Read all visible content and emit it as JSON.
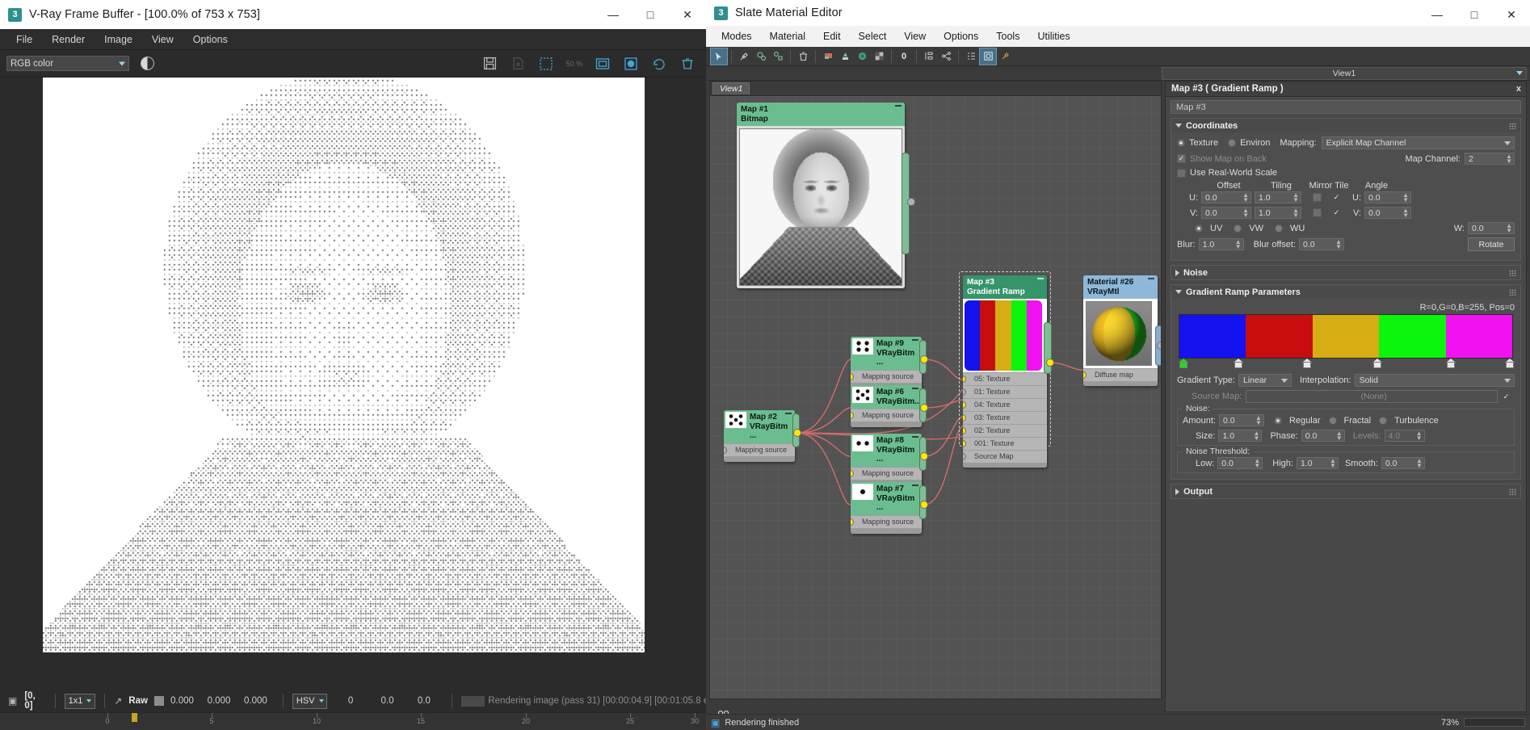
{
  "vfb": {
    "title": "V-Ray Frame Buffer - [100.0% of 753 x 753]",
    "app_icon": "3",
    "window_buttons": {
      "minimize": "—",
      "maximize": "□",
      "close": "✕"
    },
    "menu": [
      "File",
      "Render",
      "Image",
      "View",
      "Options"
    ],
    "toolbar": {
      "channel_select": "RGB color",
      "icons": [
        "save-image-icon",
        "no-image-icon",
        "region-render-icon",
        "50-percent-icon",
        "view-fit-icon",
        "color-corrections-icon",
        "render-last-icon",
        "trash-icon"
      ],
      "zoom_label": "50 %"
    },
    "status": {
      "pixel_coord": "[0, 0]",
      "zoom": "1x1",
      "mode": "Raw",
      "ch1": "0.000",
      "ch2": "0.000",
      "ch3": "0.000",
      "colorspace": "HSV",
      "hsv_h": "0",
      "hsv_s": "0.0",
      "hsv_v": "0.0",
      "message": "Rendering image (pass 31) [00:00:04.9] [00:01:05.8 e"
    },
    "timeline_ticks": [
      "0",
      "5",
      "10",
      "15",
      "20",
      "25",
      "30"
    ]
  },
  "sme": {
    "title": "Slate Material Editor",
    "app_icon": "3",
    "window_buttons": {
      "minimize": "—",
      "maximize": "□",
      "close": "✕"
    },
    "menu": [
      "Modes",
      "Material",
      "Edit",
      "Select",
      "View",
      "Options",
      "Tools",
      "Utilities"
    ],
    "toolbar_icons": [
      "select-arrow-icon",
      "pick-material-icon",
      "highlight-assets-icon",
      "move-children-icon",
      "delete-icon",
      "show-shaded-icon",
      "assign-to-selection-icon",
      "show-in-viewport-icon",
      "show-background-icon",
      "zero-icon",
      "lay-out-all-icon",
      "lay-out-children-icon",
      "list-view-icon",
      "material-map-browser-icon",
      "parameter-editor-icon"
    ],
    "view_selector": "View1",
    "graph_tab": "View1",
    "status_text": "Rendering finished",
    "zoom_percent": "73%",
    "nodes": [
      {
        "id": "map1",
        "title": "Map #1",
        "subtitle": "Bitmap",
        "type": "bitmap-portrait",
        "color": "#6bbd8f"
      },
      {
        "id": "map9",
        "title": "Map #9",
        "subtitle": "VRayBitm ...",
        "type": "dice-4",
        "color": "#6bbd8f",
        "socket": "Mapping source"
      },
      {
        "id": "map6",
        "title": "Map #6",
        "subtitle": "VRayBitm...",
        "type": "dice-5",
        "color": "#6bbd8f",
        "socket": "Mapping source"
      },
      {
        "id": "map2",
        "title": "Map #2",
        "subtitle": "VRayBitm ...",
        "type": "dice-5",
        "color": "#6bbd8f",
        "socket": "Mapping source"
      },
      {
        "id": "map8",
        "title": "Map #8",
        "subtitle": "VRayBitm ...",
        "type": "dice-2",
        "color": "#6bbd8f",
        "socket": "Mapping source"
      },
      {
        "id": "map7",
        "title": "Map #7",
        "subtitle": "VRayBitm ...",
        "type": "dice-1",
        "color": "#6bbd8f",
        "socket": "Mapping source"
      },
      {
        "id": "map3",
        "title": "Map #3",
        "subtitle": "Gradient Ramp",
        "type": "gradient",
        "color": "#35946a",
        "sockets": [
          "05: Texture",
          "01: Texture",
          "04: Texture",
          "03: Texture",
          "02: Texture",
          "001: Texture",
          "Source Map"
        ]
      },
      {
        "id": "mat26",
        "title": "Material #26",
        "subtitle": "VRayMtl",
        "type": "sphere",
        "color": "#8fb8d8",
        "socket": "Diffuse map"
      }
    ]
  },
  "params": {
    "panel_title": "Map #3  ( Gradient Ramp )",
    "close_label": "x",
    "map_name": "Map #3",
    "coordinates": {
      "header": "Coordinates",
      "texture_label": "Texture",
      "environ_label": "Environ",
      "mapping_label": "Mapping:",
      "mapping_value": "Explicit Map Channel",
      "show_map_on_back": "Show Map on Back",
      "map_channel_label": "Map Channel:",
      "map_channel_value": "2",
      "use_real_world_scale": "Use Real-World Scale",
      "col_offset": "Offset",
      "col_tiling": "Tiling",
      "col_mirror_tile": "Mirror Tile",
      "col_angle": "Angle",
      "u_label": "U:",
      "v_label": "V:",
      "w_label": "W:",
      "offset_u": "0.0",
      "offset_v": "0.0",
      "tiling_u": "1.0",
      "tiling_v": "1.0",
      "angle_u": "0.0",
      "angle_v": "0.0",
      "angle_w": "0.0",
      "uv_label": "UV",
      "vw_label": "VW",
      "wu_label": "WU",
      "blur_label": "Blur:",
      "blur_value": "1.0",
      "blur_offset_label": "Blur offset:",
      "blur_offset_value": "0.0",
      "rotate_label": "Rotate"
    },
    "noise_rollup": "Noise",
    "gradient": {
      "header": "Gradient Ramp Parameters",
      "flag_readout": "R=0,G=0,B=255, Pos=0",
      "bands": [
        "#1512f0",
        "#c70d0d",
        "#d6ad12",
        "#0bf40b",
        "#f012f0"
      ],
      "flag_positions": [
        0,
        17,
        44,
        62,
        82,
        99
      ],
      "flag_colors": [
        "#22dd22",
        "#e8e8e8",
        "#e8e8e8",
        "#e8e8e8",
        "#e8e8e8",
        "#e8e8e8"
      ],
      "gradient_type_label": "Gradient Type:",
      "gradient_type_value": "Linear",
      "interpolation_label": "Interpolation:",
      "interpolation_value": "Solid",
      "source_map_label": "Source Map:",
      "source_map_value": "(None)",
      "noise_legend": "Noise:",
      "amount_label": "Amount:",
      "amount_value": "0.0",
      "regular_label": "Regular",
      "fractal_label": "Fractal",
      "turbulence_label": "Turbulence",
      "size_label": "Size:",
      "size_value": "1.0",
      "phase_label": "Phase:",
      "phase_value": "0.0",
      "levels_label": "Levels:",
      "levels_value": "4.0",
      "threshold_legend": "Noise Threshold:",
      "low_label": "Low:",
      "low_value": "0.0",
      "high_label": "High:",
      "high_value": "1.0",
      "smooth_label": "Smooth:",
      "smooth_value": "0.0"
    },
    "output_rollup": "Output"
  }
}
